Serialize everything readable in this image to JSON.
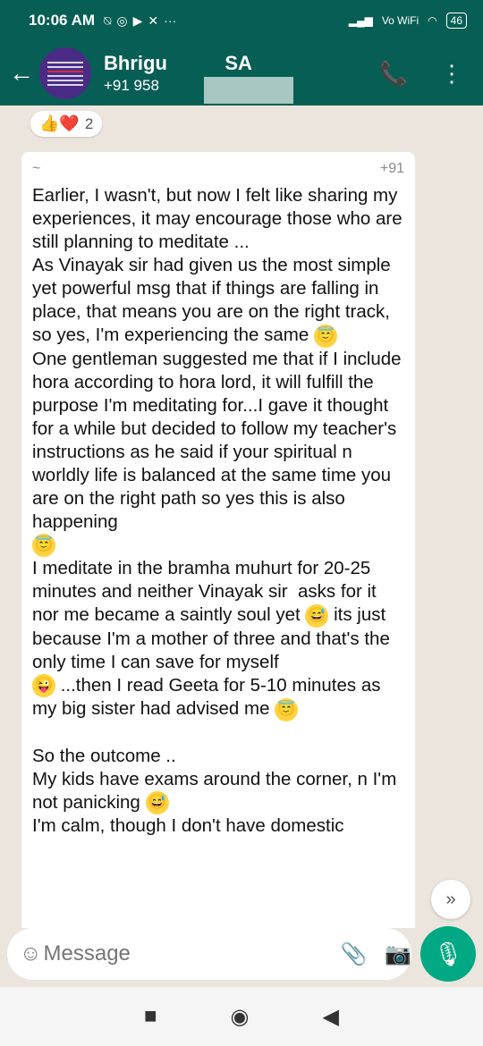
{
  "status_bar": {
    "time": "10:06 AM",
    "icons": [
      "notification-off-icon",
      "whatsapp-icon",
      "youtube-icon",
      "mute-icon",
      "more-icon"
    ],
    "network": "Vo WiFi",
    "battery": "46"
  },
  "header": {
    "title": "Bhrigu",
    "title_suffix": "SA",
    "subtitle": "+91 958",
    "back_icon": "back-arrow-icon",
    "call_icon": "add-call-icon",
    "menu_icon": "more-vert-icon"
  },
  "reaction": {
    "emojis": "👍❤️",
    "count": "2"
  },
  "message": {
    "sender_left": "~",
    "sender_right": "+91",
    "p1": "Earlier, I wasn't, but now I felt like sharing my experiences, it may encourage those who are still planning to meditate ...\nAs Vinayak sir had given us the most simple yet powerful msg that if things are falling in place, that means you are on the right track, so yes, I'm experiencing the same",
    "p2": "One gentleman suggested me that if I include hora according to hora lord, it will fulfill the purpose I'm meditating for...I gave it thought for a while but decided to follow my teacher's instructions as he said if your spiritual n worldly life is balanced at the same time you are on the right path so yes this is also happening",
    "p3a": "I meditate in the bramha muhurt for 20-25 minutes and neither Vinayak sir  asks for it nor me became a saintly soul yet",
    "p3b": " its just because I'm a mother of three and that's the only time I can save for myself",
    "p3c": " ...then I read Geeta for 5-10 minutes as my big sister had advised me",
    "p4": "\nSo the outcome ..\nMy kids have exams around the corner, n I'm not panicking",
    "p5": "I'm calm, though I don't have domestic"
  },
  "composer": {
    "placeholder": "Message"
  }
}
